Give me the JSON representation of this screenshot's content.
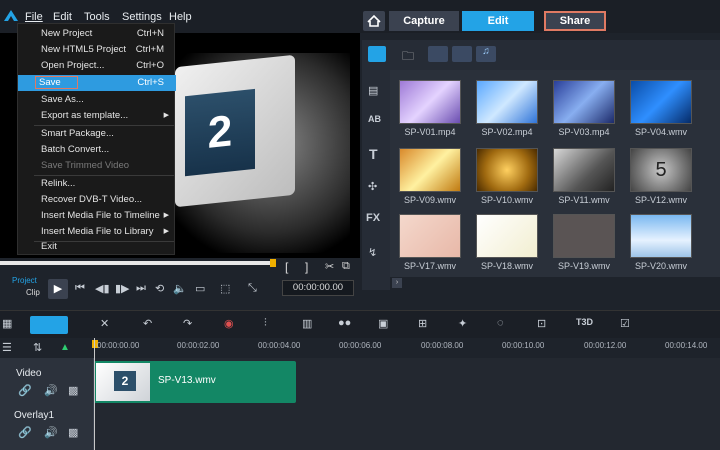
{
  "menubar": {
    "items": [
      "File",
      "Edit",
      "Tools",
      "Settings",
      "Help"
    ]
  },
  "tabs": {
    "home": "home-icon",
    "capture": "Capture",
    "edit": "Edit",
    "share": "Share"
  },
  "colors": {
    "accent": "#23a3e6",
    "highlight": "#e07a63",
    "clip": "#138765",
    "menu_select": "#2e9be0"
  },
  "file_menu": [
    {
      "label": "New Project",
      "shortcut": "Ctrl+N"
    },
    {
      "label": "New HTML5 Project",
      "shortcut": "Ctrl+M"
    },
    {
      "label": "Open Project...",
      "shortcut": "Ctrl+O"
    },
    {
      "label": "Save",
      "shortcut": "Ctrl+S"
    },
    {
      "label": "Save As...",
      "shortcut": ""
    },
    {
      "label": "Export as template...",
      "shortcut": ""
    },
    {
      "label": "Smart Package...",
      "shortcut": ""
    },
    {
      "label": "Batch Convert...",
      "shortcut": ""
    },
    {
      "label": "Save Trimmed Video",
      "shortcut": ""
    },
    {
      "label": "Relink...",
      "shortcut": ""
    },
    {
      "label": "Recover DVB-T Video...",
      "shortcut": ""
    },
    {
      "label": "Insert Media File to Timeline",
      "shortcut": ""
    },
    {
      "label": "Insert Media File to Library",
      "shortcut": ""
    },
    {
      "label": "Exit",
      "shortcut": ""
    }
  ],
  "preview": {
    "number": "2",
    "project_label": "Project",
    "clip_label": "Clip",
    "timecode": "00:00:00.00"
  },
  "library": {
    "items": [
      "SP-V01.mp4",
      "SP-V02.mp4",
      "SP-V03.mp4",
      "SP-V04.wmv",
      "SP-V09.wmv",
      "SP-V10.wmv",
      "SP-V11.wmv",
      "SP-V12.wmv",
      "SP-V17.wmv",
      "SP-V18.wmv",
      "SP-V19.wmv",
      "SP-V20.wmv"
    ],
    "fx_label": "FX",
    "t_label": "T",
    "ab_label": "AB"
  },
  "toolbar": {
    "t3d_label": "T3D"
  },
  "ruler": [
    "00:00:00.00",
    "00:00:02.00",
    "00:00:04.00",
    "00:00:06.00",
    "00:00:08.00",
    "00:00:10.00",
    "00:00:12.00",
    "00:00:14.00"
  ],
  "tracks": {
    "video": "Video",
    "overlay": "Overlay1"
  },
  "clip": {
    "name": "SP-V13.wmv",
    "thumb_number": "2"
  }
}
